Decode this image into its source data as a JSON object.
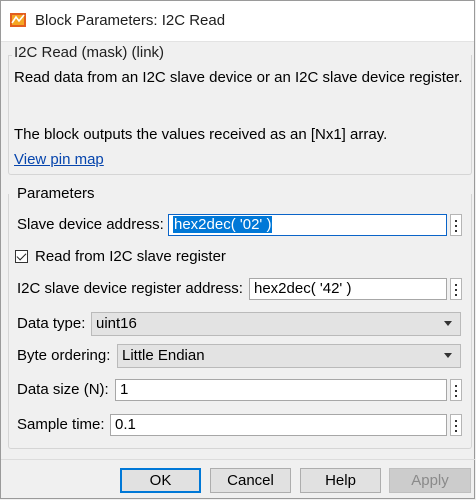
{
  "window": {
    "title": "Block Parameters: I2C Read"
  },
  "mask": {
    "title": "I2C Read (mask) (link)",
    "description": "Read data from an I2C slave device or an I2C slave device register.",
    "output_note": "The block outputs the values received as an [Nx1] array.",
    "pin_map_link": "View pin map"
  },
  "parameters": {
    "legend": "Parameters",
    "slave_address": {
      "label": "Slave device address:",
      "value": "hex2dec( '02' )"
    },
    "read_register": {
      "label": "Read from I2C slave register",
      "checked": true
    },
    "register_address": {
      "label": "I2C slave device register address:",
      "value": "hex2dec( '42' )"
    },
    "data_type": {
      "label": "Data type:",
      "value": "uint16"
    },
    "byte_ordering": {
      "label": "Byte ordering:",
      "value": "Little Endian"
    },
    "data_size": {
      "label": "Data size (N):",
      "value": "1"
    },
    "sample_time": {
      "label": "Sample time:",
      "value": "0.1"
    }
  },
  "buttons": {
    "ok": "OK",
    "cancel": "Cancel",
    "help": "Help",
    "apply": "Apply"
  },
  "colors": {
    "selection": "#0078d7",
    "link": "#0645ad",
    "focus_border": "#0a64c8"
  }
}
